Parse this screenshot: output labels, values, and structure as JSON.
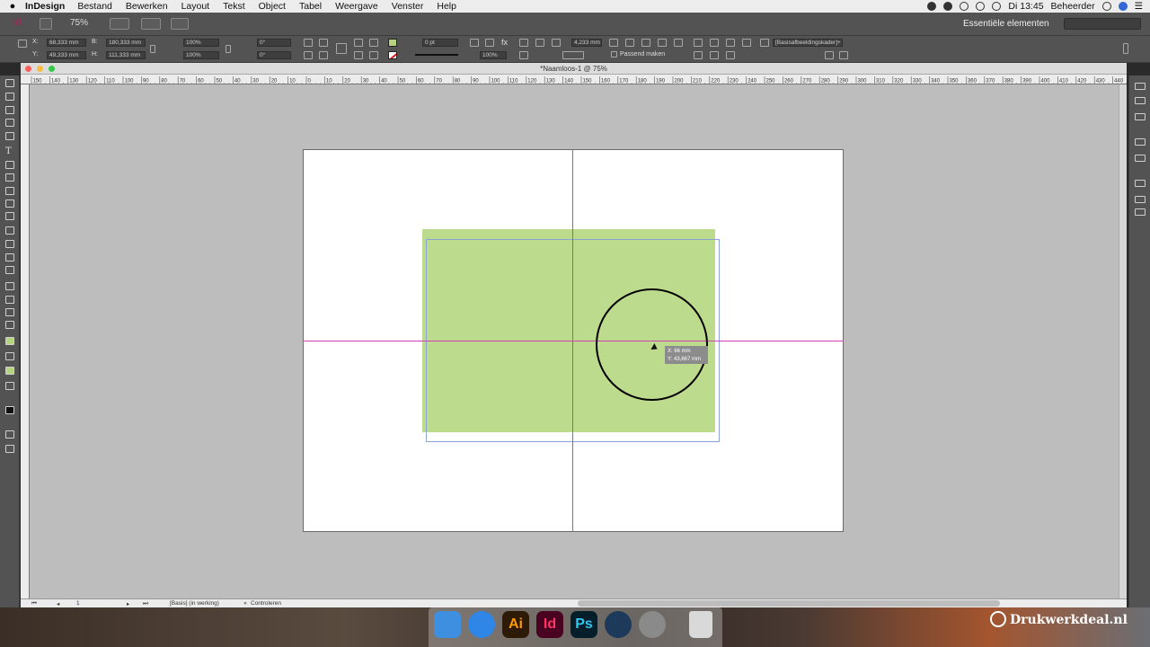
{
  "menubar": {
    "app_name": "InDesign",
    "menus": [
      "Bestand",
      "Bewerken",
      "Layout",
      "Tekst",
      "Object",
      "Tabel",
      "Weergave",
      "Venster",
      "Help"
    ],
    "clock": "Di 13:45",
    "user": "Beheerder"
  },
  "appbar": {
    "zoom": "75%",
    "workspace": "Essentiële elementen"
  },
  "control": {
    "x_label": "X:",
    "x_value": "68,333 mm",
    "y_label": "Y:",
    "y_value": "49,333 mm",
    "w_label": "B:",
    "w_value": "180,333 mm",
    "h_label": "H:",
    "h_value": "111,333 mm",
    "scale_x": "100%",
    "scale_y": "100%",
    "rotate": "0°",
    "shear": "0°",
    "stroke_weight": "0 pt",
    "opacity": "100%",
    "offset": "4,233 mm",
    "fit_label": "Passend maken",
    "object_style": "[Basisafbeeldingskader]+"
  },
  "document": {
    "title": "*Naamloos-1 @ 75%",
    "ruler_labels": [
      "150",
      "140",
      "130",
      "120",
      "110",
      "100",
      "90",
      "80",
      "70",
      "60",
      "50",
      "40",
      "30",
      "20",
      "10",
      "0",
      "10",
      "20",
      "30",
      "40",
      "50",
      "60",
      "70",
      "80",
      "90",
      "100",
      "110",
      "120",
      "130",
      "140",
      "150",
      "160",
      "170",
      "180",
      "190",
      "200",
      "210",
      "220",
      "230",
      "240",
      "250",
      "260",
      "270",
      "280",
      "290",
      "300",
      "310",
      "320",
      "330",
      "340",
      "350",
      "360",
      "370",
      "380",
      "390",
      "400",
      "410",
      "420",
      "430",
      "440"
    ],
    "tooltip_x": "X: 66 mm",
    "tooltip_y": "Y: 43,667 mm",
    "page_number": "1",
    "master_state": "[Basis] (in werking)",
    "preflight": "Controleren"
  },
  "dock": {
    "apps": [
      {
        "name": "Finder",
        "label": ""
      },
      {
        "name": "Safari",
        "label": ""
      },
      {
        "name": "Illustrator",
        "label": "Ai"
      },
      {
        "name": "InDesign",
        "label": "Id"
      },
      {
        "name": "Photoshop",
        "label": "Ps"
      },
      {
        "name": "QuickTime",
        "label": ""
      },
      {
        "name": "System Preferences",
        "label": ""
      },
      {
        "name": "Trash",
        "label": ""
      }
    ]
  },
  "watermark": "Drukwerkdeal.nl",
  "colors": {
    "frame_fill": "#bddb8c",
    "guide": "#d23fb7",
    "frame_outline": "#8aa4d6"
  }
}
